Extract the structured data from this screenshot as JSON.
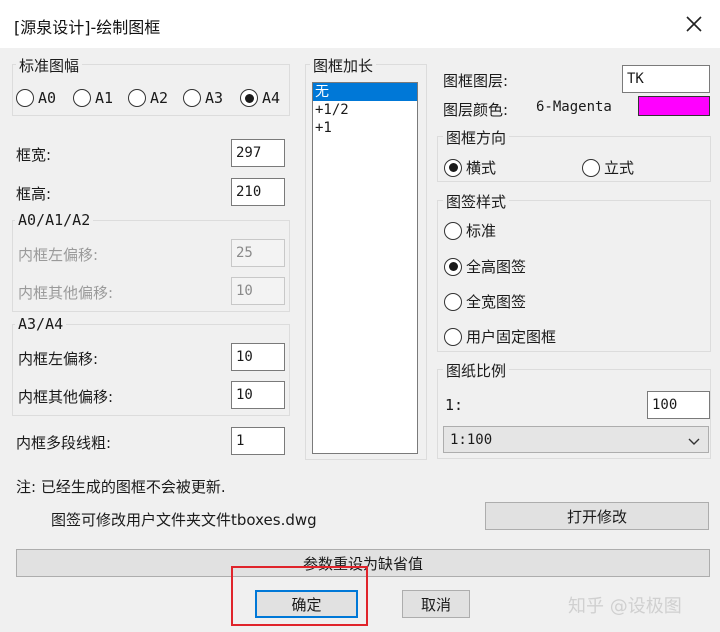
{
  "window": {
    "title": "[源泉设计]-绘制图框"
  },
  "paper_size": {
    "title": "标准图幅",
    "options": [
      "A0",
      "A1",
      "A2",
      "A3",
      "A4"
    ],
    "selected": "A4"
  },
  "frame_width": {
    "label": "框宽:",
    "value": "297"
  },
  "frame_height": {
    "label": "框高:",
    "value": "210"
  },
  "a0a1a2": {
    "title": "A0/A1/A2",
    "left_offset": {
      "label": "内框左偏移:",
      "value": "25"
    },
    "other_offset": {
      "label": "内框其他偏移:",
      "value": "10"
    }
  },
  "a3a4": {
    "title": "A3/A4",
    "left_offset": {
      "label": "内框左偏移:",
      "value": "10"
    },
    "other_offset": {
      "label": "内框其他偏移:",
      "value": "10"
    }
  },
  "polyline_width": {
    "label": "内框多段线粗:",
    "value": "1"
  },
  "lengthen": {
    "title": "图框加长",
    "items": [
      "无",
      "+1/2",
      "+1"
    ],
    "selected_index": 0
  },
  "layer": {
    "label": "图框图层:",
    "value": "TK",
    "color_label": "图层颜色:",
    "color_value": "6-Magenta",
    "color_hex": "#ff00ff"
  },
  "orientation": {
    "title": "图框方向",
    "options": [
      "横式",
      "立式"
    ],
    "selected": "横式"
  },
  "title_block": {
    "title": "图签样式",
    "options": [
      "标准",
      "全高图签",
      "全宽图签",
      "用户固定图框"
    ],
    "selected": "全高图签"
  },
  "scale": {
    "title": "图纸比例",
    "prefix": "1:",
    "value": "100",
    "dropdown_selected": "1:100"
  },
  "notes": {
    "line1": "注: 已经生成的图框不会被更新.",
    "line2": "图签可修改用户文件夹文件tboxes.dwg"
  },
  "buttons": {
    "open_modify": "打开修改",
    "reset_defaults": "参数重设为缺省值",
    "ok": "确定",
    "cancel": "取消"
  },
  "watermark": "知乎 @设极图"
}
